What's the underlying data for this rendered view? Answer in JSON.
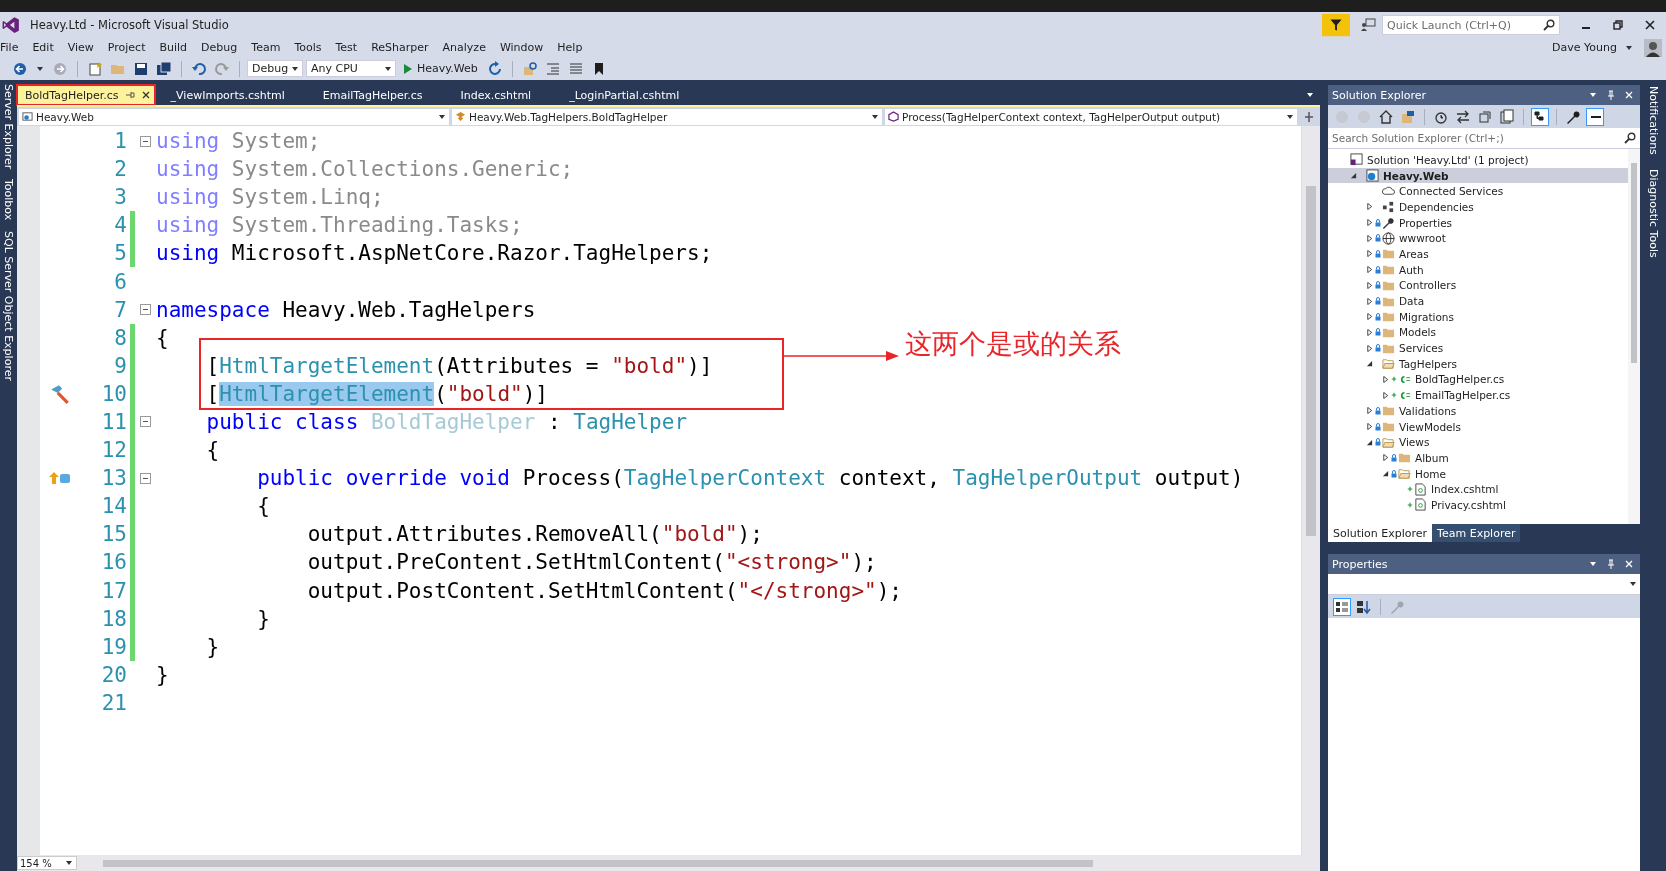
{
  "window": {
    "title": "Heavy.Ltd - Microsoft Visual Studio",
    "quick_launch_placeholder": "Quick Launch (Ctrl+Q)",
    "user": "Dave Young"
  },
  "menu": [
    "File",
    "Edit",
    "View",
    "Project",
    "Build",
    "Debug",
    "Team",
    "Tools",
    "Test",
    "ReSharper",
    "Analyze",
    "Window",
    "Help"
  ],
  "toolbar": {
    "configuration": "Debug",
    "platform": "Any CPU",
    "start": "Heavy.Web"
  },
  "left_strip": [
    "Server Explorer",
    "Toolbox",
    "SQL Server Object Explorer"
  ],
  "right_strip": [
    "Notifications",
    "Diagnostic Tools"
  ],
  "tabs": [
    {
      "label": "BoldTagHelper.cs",
      "selected": true,
      "circled": true
    },
    {
      "label": "_ViewImports.cshtml",
      "selected": false,
      "circled": false
    },
    {
      "label": "EmailTagHelper.cs",
      "selected": false,
      "circled": false
    },
    {
      "label": "Index.cshtml",
      "selected": false,
      "circled": false
    },
    {
      "label": "_LoginPartial.cshtml",
      "selected": false,
      "circled": false
    }
  ],
  "navigation": {
    "project": "Heavy.Web",
    "type": "Heavy.Web.TagHelpers.BoldTagHelper",
    "member": "Process(TagHelperContext context, TagHelperOutput output)"
  },
  "code": [
    {
      "n": "1",
      "fold": true,
      "changed": false,
      "tokens": [
        {
          "kind": "kwdim",
          "text": "using"
        },
        {
          "kind": "dim",
          "text": " System;"
        }
      ]
    },
    {
      "n": "2",
      "fold": false,
      "changed": false,
      "tokens": [
        {
          "kind": "kwdim",
          "text": "using"
        },
        {
          "kind": "dim",
          "text": " System.Collections.Generic;"
        }
      ]
    },
    {
      "n": "3",
      "fold": false,
      "changed": false,
      "tokens": [
        {
          "kind": "kwdim",
          "text": "using"
        },
        {
          "kind": "dim",
          "text": " System.Linq;"
        }
      ]
    },
    {
      "n": "4",
      "fold": false,
      "changed": true,
      "tokens": [
        {
          "kind": "kwdim",
          "text": "using"
        },
        {
          "kind": "dim",
          "text": " System.Threading.Tasks;"
        }
      ]
    },
    {
      "n": "5",
      "fold": false,
      "changed": true,
      "tokens": [
        {
          "kind": "kw",
          "text": "using"
        },
        {
          "kind": "plain",
          "text": " Microsoft.AspNetCore.Razor.TagHelpers;"
        }
      ]
    },
    {
      "n": "6",
      "fold": false,
      "changed": false
    },
    {
      "n": "7",
      "fold": true,
      "changed": false,
      "tokens": [
        {
          "kind": "kw",
          "text": "namespace"
        },
        {
          "kind": "plain",
          "text": " Heavy.Web.TagHelpers"
        }
      ]
    },
    {
      "n": "8",
      "fold": false,
      "changed": true,
      "tokens": [
        {
          "kind": "plain",
          "text": "{"
        }
      ]
    },
    {
      "n": "9",
      "fold": false,
      "changed": true,
      "tokens": [
        {
          "kind": "plain",
          "text": "    ["
        },
        {
          "kind": "type",
          "text": "HtmlTargetElement"
        },
        {
          "kind": "plain",
          "text": "(Attributes = "
        },
        {
          "kind": "str",
          "text": "\"bold\""
        },
        {
          "kind": "plain",
          "text": ")]"
        }
      ]
    },
    {
      "n": "10",
      "fold": false,
      "changed": true,
      "kind": "quick-action",
      "tokens": [
        {
          "kind": "plain",
          "text": "    ["
        },
        {
          "kind": "sel",
          "text": "HtmlTargetElement"
        },
        {
          "kind": "plain",
          "text": "("
        },
        {
          "kind": "str",
          "text": "\"bold\""
        },
        {
          "kind": "plain",
          "text": ")]"
        }
      ]
    },
    {
      "n": "11",
      "fold": true,
      "changed": true,
      "tokens": [
        {
          "kind": "kw",
          "text": "    public class "
        },
        {
          "kind": "typedim",
          "text": "BoldTagHelper"
        },
        {
          "kind": "plain",
          "text": " : "
        },
        {
          "kind": "type",
          "text": "TagHelper"
        }
      ]
    },
    {
      "n": "12",
      "fold": false,
      "changed": true,
      "tokens": [
        {
          "kind": "plain",
          "text": "    {"
        }
      ]
    },
    {
      "n": "13",
      "fold": true,
      "changed": true,
      "kind": "override",
      "tokens": [
        {
          "kind": "kw",
          "text": "        public override void "
        },
        {
          "kind": "plain",
          "text": "Process("
        },
        {
          "kind": "type",
          "text": "TagHelperContext"
        },
        {
          "kind": "plain",
          "text": " context, "
        },
        {
          "kind": "type",
          "text": "TagHelperOutput"
        },
        {
          "kind": "plain",
          "text": " output)"
        }
      ]
    },
    {
      "n": "14",
      "fold": false,
      "changed": true,
      "tokens": [
        {
          "kind": "plain",
          "text": "        {"
        }
      ]
    },
    {
      "n": "15",
      "fold": false,
      "changed": true,
      "tokens": [
        {
          "kind": "plain",
          "text": "            output.Attributes.RemoveAll("
        },
        {
          "kind": "str",
          "text": "\"bold\""
        },
        {
          "kind": "plain",
          "text": ");"
        }
      ]
    },
    {
      "n": "16",
      "fold": false,
      "changed": true,
      "tokens": [
        {
          "kind": "plain",
          "text": "            output.PreContent.SetHtmlContent("
        },
        {
          "kind": "str",
          "text": "\"<strong>\""
        },
        {
          "kind": "plain",
          "text": ");"
        }
      ]
    },
    {
      "n": "17",
      "fold": false,
      "changed": true,
      "tokens": [
        {
          "kind": "plain",
          "text": "            output.PostContent.SetHtmlContent("
        },
        {
          "kind": "str",
          "text": "\"</strong>\""
        },
        {
          "kind": "plain",
          "text": ");"
        }
      ]
    },
    {
      "n": "18",
      "fold": false,
      "changed": true,
      "tokens": [
        {
          "kind": "plain",
          "text": "        }"
        }
      ]
    },
    {
      "n": "19",
      "fold": false,
      "changed": true,
      "tokens": [
        {
          "kind": "plain",
          "text": "    }"
        }
      ]
    },
    {
      "n": "20",
      "fold": false,
      "changed": false,
      "tokens": [
        {
          "kind": "plain",
          "text": "}"
        }
      ]
    },
    {
      "n": "21",
      "fold": false,
      "changed": false
    }
  ],
  "annotation": {
    "text": "这两个是或的关系"
  },
  "zoom": "154 %",
  "solution_explorer": {
    "title": "Solution Explorer",
    "search_placeholder": "Search Solution Explorer (Ctrl+;)",
    "tree": [
      {
        "label": "Solution 'Heavy.Ltd' (1 project)",
        "kind": "solution",
        "locked": false,
        "added": false,
        "selected": false,
        "children": [
          {
            "label": "Heavy.Web",
            "kind": "project",
            "expanded": true,
            "locked": false,
            "added": false,
            "selected": true,
            "children": [
              {
                "label": "Connected Services",
                "kind": "service",
                "locked": false,
                "added": false,
                "selected": false
              },
              {
                "label": "Dependencies",
                "kind": "dependencies",
                "expanded": false,
                "locked": false,
                "added": false,
                "selected": false
              },
              {
                "label": "Properties",
                "kind": "properties",
                "expanded": false,
                "locked": true,
                "added": false,
                "selected": false
              },
              {
                "label": "wwwroot",
                "kind": "webroot",
                "expanded": false,
                "locked": true,
                "added": false,
                "selected": false
              },
              {
                "label": "Areas",
                "kind": "folder",
                "expanded": false,
                "locked": true,
                "added": false,
                "selected": false
              },
              {
                "label": "Auth",
                "kind": "folder",
                "expanded": false,
                "locked": true,
                "added": false,
                "selected": false
              },
              {
                "label": "Controllers",
                "kind": "folder",
                "expanded": false,
                "locked": true,
                "added": false,
                "selected": false
              },
              {
                "label": "Data",
                "kind": "folder",
                "expanded": false,
                "locked": true,
                "added": false,
                "selected": false
              },
              {
                "label": "Migrations",
                "kind": "folder",
                "expanded": false,
                "locked": true,
                "added": false,
                "selected": false
              },
              {
                "label": "Models",
                "kind": "folder",
                "expanded": false,
                "locked": true,
                "added": false,
                "selected": false
              },
              {
                "label": "Services",
                "kind": "folder",
                "expanded": false,
                "locked": true,
                "added": false,
                "selected": false
              },
              {
                "label": "TagHelpers",
                "kind": "folder",
                "expanded": true,
                "locked": false,
                "added": false,
                "selected": false,
                "children": [
                  {
                    "label": "BoldTagHelper.cs",
                    "kind": "class",
                    "expanded": false,
                    "locked": false,
                    "added": true,
                    "selected": false
                  },
                  {
                    "label": "EmailTagHelper.cs",
                    "kind": "class",
                    "expanded": false,
                    "locked": false,
                    "added": true,
                    "selected": false
                  }
                ]
              },
              {
                "label": "Validations",
                "kind": "folder",
                "expanded": false,
                "locked": true,
                "added": false,
                "selected": false
              },
              {
                "label": "ViewModels",
                "kind": "folder",
                "expanded": false,
                "locked": true,
                "added": false,
                "selected": false
              },
              {
                "label": "Views",
                "kind": "folder",
                "expanded": true,
                "locked": true,
                "added": false,
                "selected": false,
                "children": [
                  {
                    "label": "Album",
                    "kind": "folder",
                    "expanded": false,
                    "locked": true,
                    "added": false,
                    "selected": false
                  },
                  {
                    "label": "Home",
                    "kind": "folder",
                    "expanded": true,
                    "locked": true,
                    "added": false,
                    "selected": false,
                    "children": [
                      {
                        "label": "Index.cshtml",
                        "kind": "view",
                        "locked": false,
                        "added": true,
                        "selected": false
                      },
                      {
                        "label": "Privacy.cshtml",
                        "kind": "view",
                        "locked": false,
                        "added": true,
                        "selected": false
                      }
                    ]
                  }
                ]
              }
            ]
          }
        ]
      }
    ],
    "tabs": [
      {
        "label": "Solution Explorer",
        "selected": true
      },
      {
        "label": "Team Explorer",
        "selected": false
      }
    ]
  },
  "properties": {
    "title": "Properties"
  }
}
